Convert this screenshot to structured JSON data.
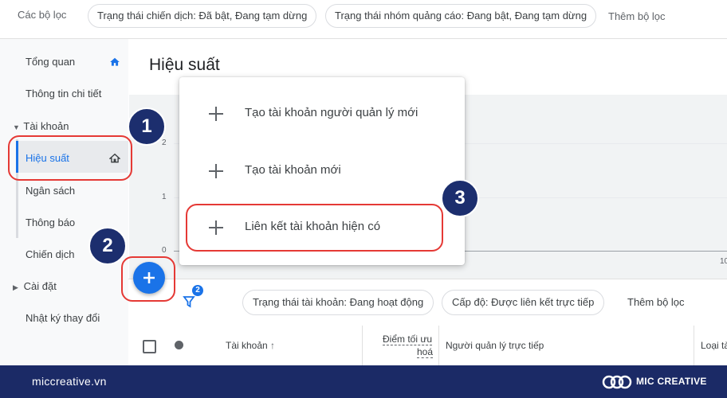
{
  "top_filters": {
    "label": "Các bộ lọc",
    "chips": [
      "Trạng thái chiến dịch: Đã bật, Đang tạm dừng",
      "Trạng thái nhóm quảng cáo: Đang bật, Đang tạm dừng"
    ],
    "add_filter": "Thêm bộ lọc"
  },
  "sidebar": {
    "items": [
      {
        "label": "Tổng quan",
        "icon": "home-icon"
      },
      {
        "label": "Thông tin chi tiết"
      },
      {
        "label": "Tài khoản",
        "expanded": true
      },
      {
        "label": "Hiệu suất",
        "icon": "home-icon",
        "active": true
      },
      {
        "label": "Ngân sách"
      },
      {
        "label": "Thông báo"
      },
      {
        "label": "Chiến dịch"
      },
      {
        "label": "Cài đặt",
        "expanded": false
      },
      {
        "label": "Nhật ký thay đổi"
      }
    ]
  },
  "main": {
    "title": "Hiệu suất",
    "chart_ticks": [
      "2",
      "1",
      "0"
    ],
    "x_tick_partial": "10"
  },
  "menu": {
    "items": [
      "Tạo tài khoản người quản lý mới",
      "Tạo tài khoản mới",
      "Liên kết tài khoản hiện có"
    ]
  },
  "badges": [
    "1",
    "2",
    "3"
  ],
  "table": {
    "filter_count": "2",
    "chips": [
      "Trạng thái tài khoản: Đang hoạt động",
      "Cấp độ: Được liên kết trực tiếp"
    ],
    "add_filter": "Thêm bộ lọc",
    "columns": {
      "account": "Tài khoản",
      "opt_score_1": "Điểm tối ưu",
      "opt_score_2": "hoá",
      "manager": "Người quản lý trực tiếp",
      "type": "Loại tà"
    }
  },
  "footer": {
    "website": "miccreative.vn",
    "brand": "MIC CREATIVE"
  },
  "colors": {
    "accent": "#1a73e8",
    "highlight": "#e53935",
    "badge": "#1c2e6e",
    "footer": "#1b2a66"
  }
}
